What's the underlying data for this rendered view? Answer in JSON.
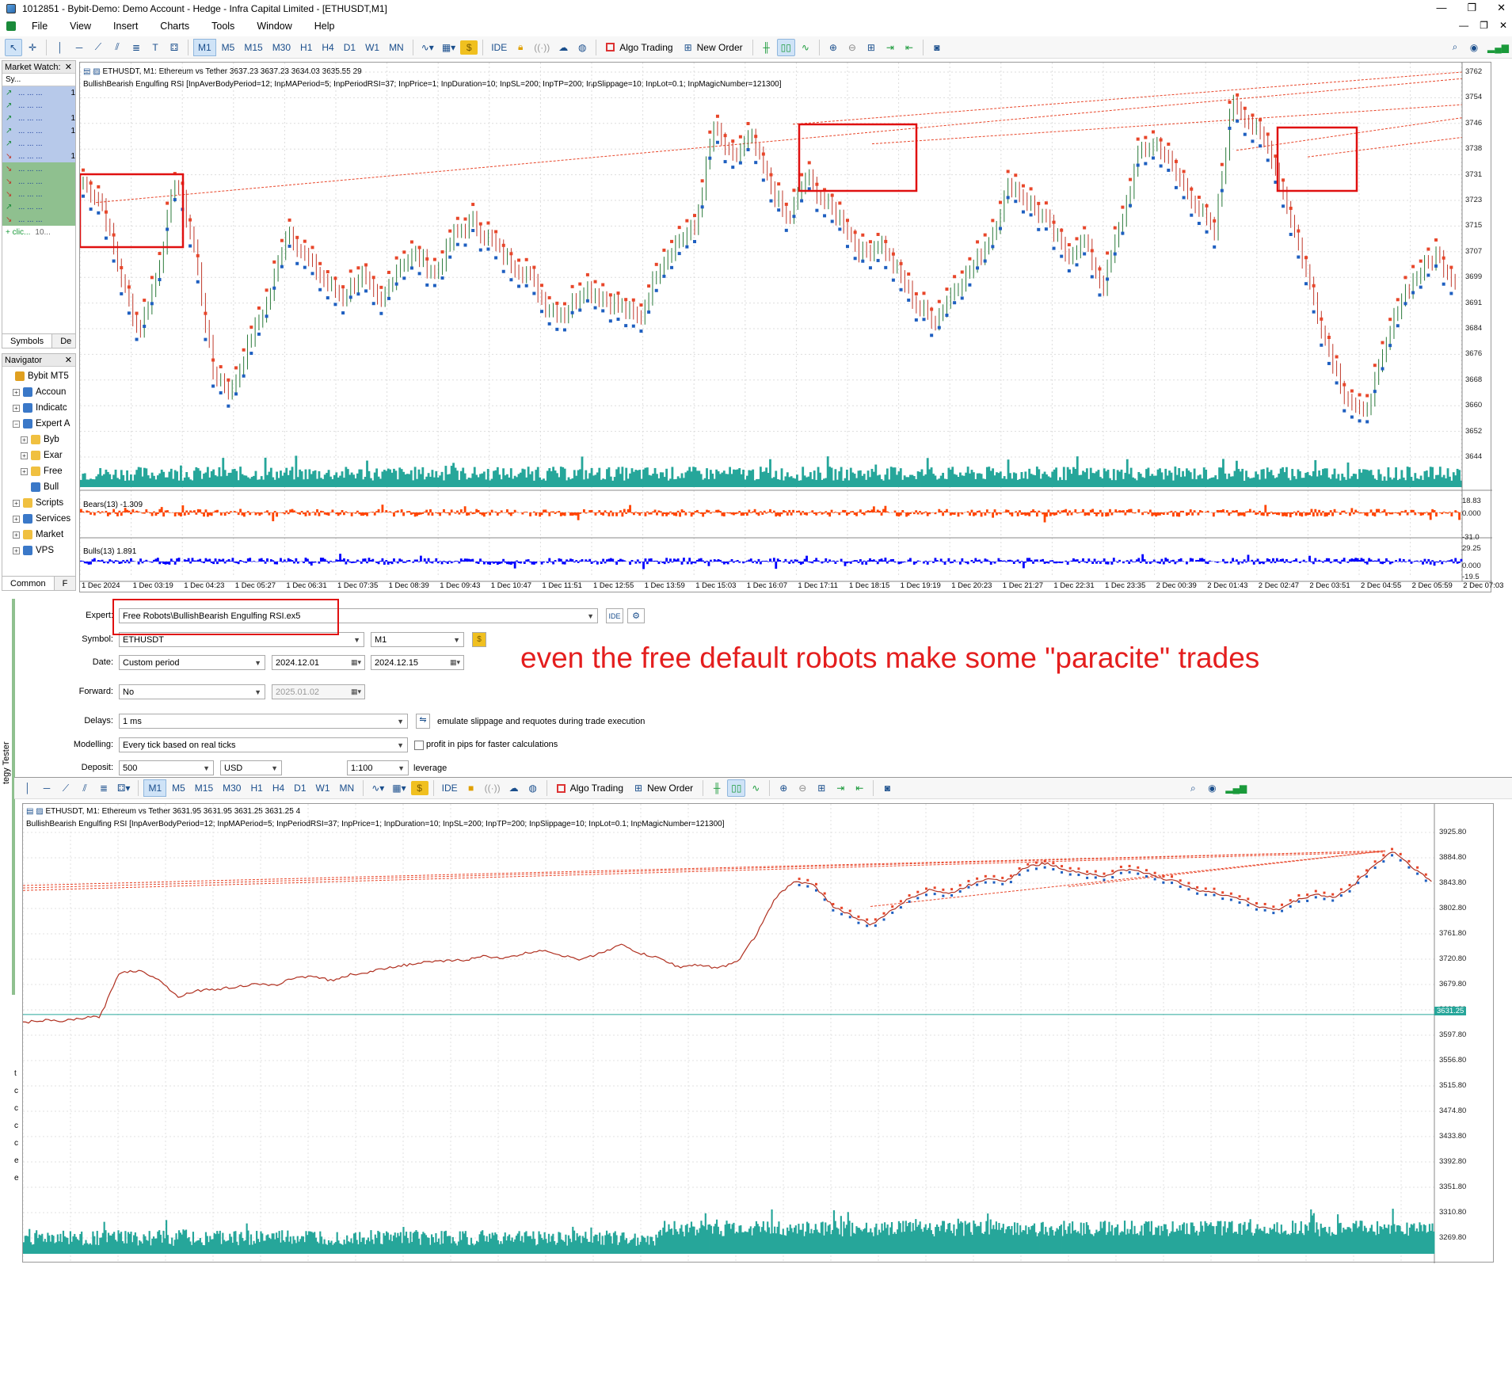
{
  "window": {
    "title": "1012851 - Bybit-Demo: Demo Account - Hedge - Infra Capital Limited - [ETHUSDT,M1]",
    "controls": [
      "—",
      "❐",
      "✕"
    ]
  },
  "menu": [
    "File",
    "View",
    "Insert",
    "Charts",
    "Tools",
    "Window",
    "Help"
  ],
  "toolbar": {
    "timeframes": [
      "M1",
      "M5",
      "M15",
      "M30",
      "H1",
      "H4",
      "D1",
      "W1",
      "MN"
    ],
    "active_timeframe": "M1",
    "ide_label": "IDE",
    "algo_trading_label": "Algo Trading",
    "new_order_label": "New Order"
  },
  "market_watch": {
    "title": "Market Watch: ",
    "header": "Sy...",
    "rows": [
      {
        "dir": "↗",
        "cols": "... ... ...",
        "last": "1",
        "color": "blue"
      },
      {
        "dir": "↗",
        "cols": "... ... ...",
        "last": "",
        "color": "blue"
      },
      {
        "dir": "↗",
        "cols": "... ... ...",
        "last": "1",
        "color": "blue"
      },
      {
        "dir": "↗",
        "cols": "... ... ...",
        "last": "1",
        "color": "blue"
      },
      {
        "dir": "↗",
        "cols": "... ... ...",
        "last": "",
        "color": "blue"
      },
      {
        "dir": "↘",
        "cols": "... ... ...",
        "last": "1",
        "color": "blue"
      },
      {
        "dir": "↘",
        "cols": "... ... ...",
        "last": "",
        "color": "green"
      },
      {
        "dir": "↘",
        "cols": "... ... ...",
        "last": "",
        "color": "green"
      },
      {
        "dir": "↘",
        "cols": "... ... ...",
        "last": "",
        "color": "green"
      },
      {
        "dir": "↗",
        "cols": "... ... ...",
        "last": "",
        "color": "green"
      },
      {
        "dir": "↘",
        "cols": "... ... ...",
        "last": "",
        "color": "green"
      }
    ],
    "add_row": "+ clic...",
    "add_count": "10...",
    "tabs": [
      "Symbols",
      "De"
    ]
  },
  "navigator": {
    "title": "Navigator",
    "items": [
      {
        "label": "Bybit MT5",
        "level": 0,
        "pm": "",
        "icon": "#e0a020"
      },
      {
        "label": "Accoun",
        "level": 1,
        "pm": "+",
        "icon": "#3a78c8"
      },
      {
        "label": "Indicatc",
        "level": 1,
        "pm": "+",
        "icon": "#3a78c8"
      },
      {
        "label": "Expert A",
        "level": 1,
        "pm": "−",
        "icon": "#3a78c8"
      },
      {
        "label": "Byb",
        "level": 2,
        "pm": "+",
        "icon": "#f0c040"
      },
      {
        "label": "Exar",
        "level": 2,
        "pm": "+",
        "icon": "#f0c040"
      },
      {
        "label": "Free",
        "level": 2,
        "pm": "+",
        "icon": "#f0c040"
      },
      {
        "label": "Bull",
        "level": 2,
        "pm": "",
        "icon": "#3a78c8"
      },
      {
        "label": "Scripts",
        "level": 1,
        "pm": "+",
        "icon": "#f0c040"
      },
      {
        "label": "Services",
        "level": 1,
        "pm": "+",
        "icon": "#3a78c8"
      },
      {
        "label": "Market",
        "level": 1,
        "pm": "+",
        "icon": "#f0c040"
      },
      {
        "label": "VPS",
        "level": 1,
        "pm": "+",
        "icon": "#3a78c8"
      }
    ],
    "tabs": [
      "Common",
      "F"
    ]
  },
  "chart_top": {
    "header": "ETHUSDT, M1:  Ethereum vs Tether  3637.23 3637.23 3634.03 3635.55  29",
    "ea_line": "BullishBearish Engulfing RSI [InpAverBodyPeriod=12; InpMAPeriod=5; InpPeriodRSI=37; InpPrice=1; InpDuration=10; InpSL=200; InpTP=200; InpSlippage=10; InpLot=0.1; InpMagicNumber=121300]",
    "price_ticks": [
      "3762",
      "3754",
      "3746",
      "3738",
      "3731",
      "3723",
      "3715",
      "3707",
      "3699",
      "3691",
      "3684",
      "3676",
      "3668",
      "3660",
      "3652",
      "3644"
    ],
    "bears_label": "Bears(13) -1.309",
    "bears_ticks": [
      "18.83",
      "0.000",
      "-31.0"
    ],
    "bulls_label": "Bulls(13) 1.891",
    "bulls_ticks": [
      "29.25",
      "0.000",
      "-19.5"
    ],
    "time_ticks": [
      "1 Dec 2024",
      "1 Dec 03:19",
      "1 Dec 04:23",
      "1 Dec 05:27",
      "1 Dec 06:31",
      "1 Dec 07:35",
      "1 Dec 08:39",
      "1 Dec 09:43",
      "1 Dec 10:47",
      "1 Dec 11:51",
      "1 Dec 12:55",
      "1 Dec 13:59",
      "1 Dec 15:03",
      "1 Dec 16:07",
      "1 Dec 17:11",
      "1 Dec 18:15",
      "1 Dec 19:19",
      "1 Dec 20:23",
      "1 Dec 21:27",
      "1 Dec 22:31",
      "1 Dec 23:35",
      "2 Dec 00:39",
      "2 Dec 01:43",
      "2 Dec 02:47",
      "2 Dec 03:51",
      "2 Dec 04:55",
      "2 Dec 05:59",
      "2 Dec 07:03"
    ],
    "price_path": [
      3728,
      3722,
      3700,
      3682,
      3700,
      3730,
      3708,
      3670,
      3664,
      3680,
      3692,
      3714,
      3705,
      3698,
      3693,
      3700,
      3690,
      3703,
      3706,
      3700,
      3712,
      3716,
      3710,
      3704,
      3700,
      3690,
      3688,
      3696,
      3693,
      3690,
      3686,
      3702,
      3710,
      3714,
      3745,
      3735,
      3742,
      3728,
      3716,
      3730,
      3722,
      3716,
      3706,
      3710,
      3700,
      3690,
      3686,
      3696,
      3702,
      3712,
      3728,
      3722,
      3716,
      3706,
      3710,
      3696,
      3716,
      3738,
      3740,
      3730,
      3722,
      3712,
      3754,
      3746,
      3738,
      3720,
      3700,
      3680,
      3664,
      3656,
      3672,
      3692,
      3700,
      3706,
      3698
    ]
  },
  "tester": {
    "expert_label": "Expert:",
    "expert_value": "Free Robots\\BullishBearish Engulfing RSI.ex5",
    "ide_btn": "IDE",
    "symbol_label": "Symbol:",
    "symbol_value": "ETHUSDT",
    "period_value": "M1",
    "date_label": "Date:",
    "date_mode": "Custom period",
    "date_from": "2024.12.01",
    "date_to": "2024.12.15",
    "forward_label": "Forward:",
    "forward_value": "No",
    "forward_date": "2025.01.02",
    "delays_label": "Delays:",
    "delays_value": "1 ms",
    "slippage_text": "emulate slippage and requotes during trade execution",
    "modelling_label": "Modelling:",
    "modelling_value": "Every tick based on real ticks",
    "pips_text": "profit in pips for faster calculations",
    "deposit_label": "Deposit:",
    "deposit_value": "500",
    "currency_value": "USD",
    "leverage_value": "1:100",
    "leverage_text": "leverage",
    "vertical_tab": "tegy Tester"
  },
  "annotation": "even the free default robots make some \"paracite\" trades",
  "chart_bottom": {
    "header": "ETHUSDT, M1:  Ethereum vs Tether  3631.95 3631.95 3631.25 3631.25  4",
    "ea_line": "BullishBearish Engulfing RSI [InpAverBodyPeriod=12; InpMAPeriod=5; InpPeriodRSI=37; InpPrice=1; InpDuration=10; InpSL=200; InpTP=200; InpSlippage=10; InpLot=0.1; InpMagicNumber=121300]",
    "price_ticks": [
      "3925.80",
      "3884.80",
      "3843.80",
      "3802.80",
      "3761.80",
      "3720.80",
      "3679.80",
      "3638.80",
      "3597.80",
      "3556.80",
      "3515.80",
      "3474.80",
      "3433.80",
      "3392.80",
      "3351.80",
      "3310.80",
      "3269.80"
    ],
    "current_price": "3631.25",
    "left_axis_marks": [
      "t",
      "c",
      "c",
      "c",
      "c",
      "e",
      "e"
    ],
    "price_path": [
      3618,
      3622,
      3620,
      3625,
      3628,
      3700,
      3702,
      3690,
      3660,
      3670,
      3672,
      3676,
      3680,
      3678,
      3690,
      3694,
      3686,
      3696,
      3700,
      3708,
      3712,
      3716,
      3718,
      3720,
      3726,
      3722,
      3730,
      3736,
      3726,
      3720,
      3732,
      3744,
      3730,
      3722,
      3708,
      3712,
      3706,
      3716,
      3760,
      3820,
      3848,
      3840,
      3806,
      3790,
      3776,
      3800,
      3820,
      3834,
      3826,
      3840,
      3852,
      3848,
      3870,
      3876,
      3866,
      3860,
      3854,
      3866,
      3862,
      3852,
      3844,
      3832,
      3826,
      3820,
      3806,
      3800,
      3816,
      3826,
      3820,
      3842,
      3872,
      3896,
      3870,
      3846
    ]
  },
  "colors": {
    "bear_orange": "#ff4500",
    "bull_blue": "#0000ff",
    "volume_teal": "#26a69a",
    "marker_red": "#e8462a",
    "marker_blue": "#1e5fc0",
    "highlight_red": "#e01010"
  }
}
